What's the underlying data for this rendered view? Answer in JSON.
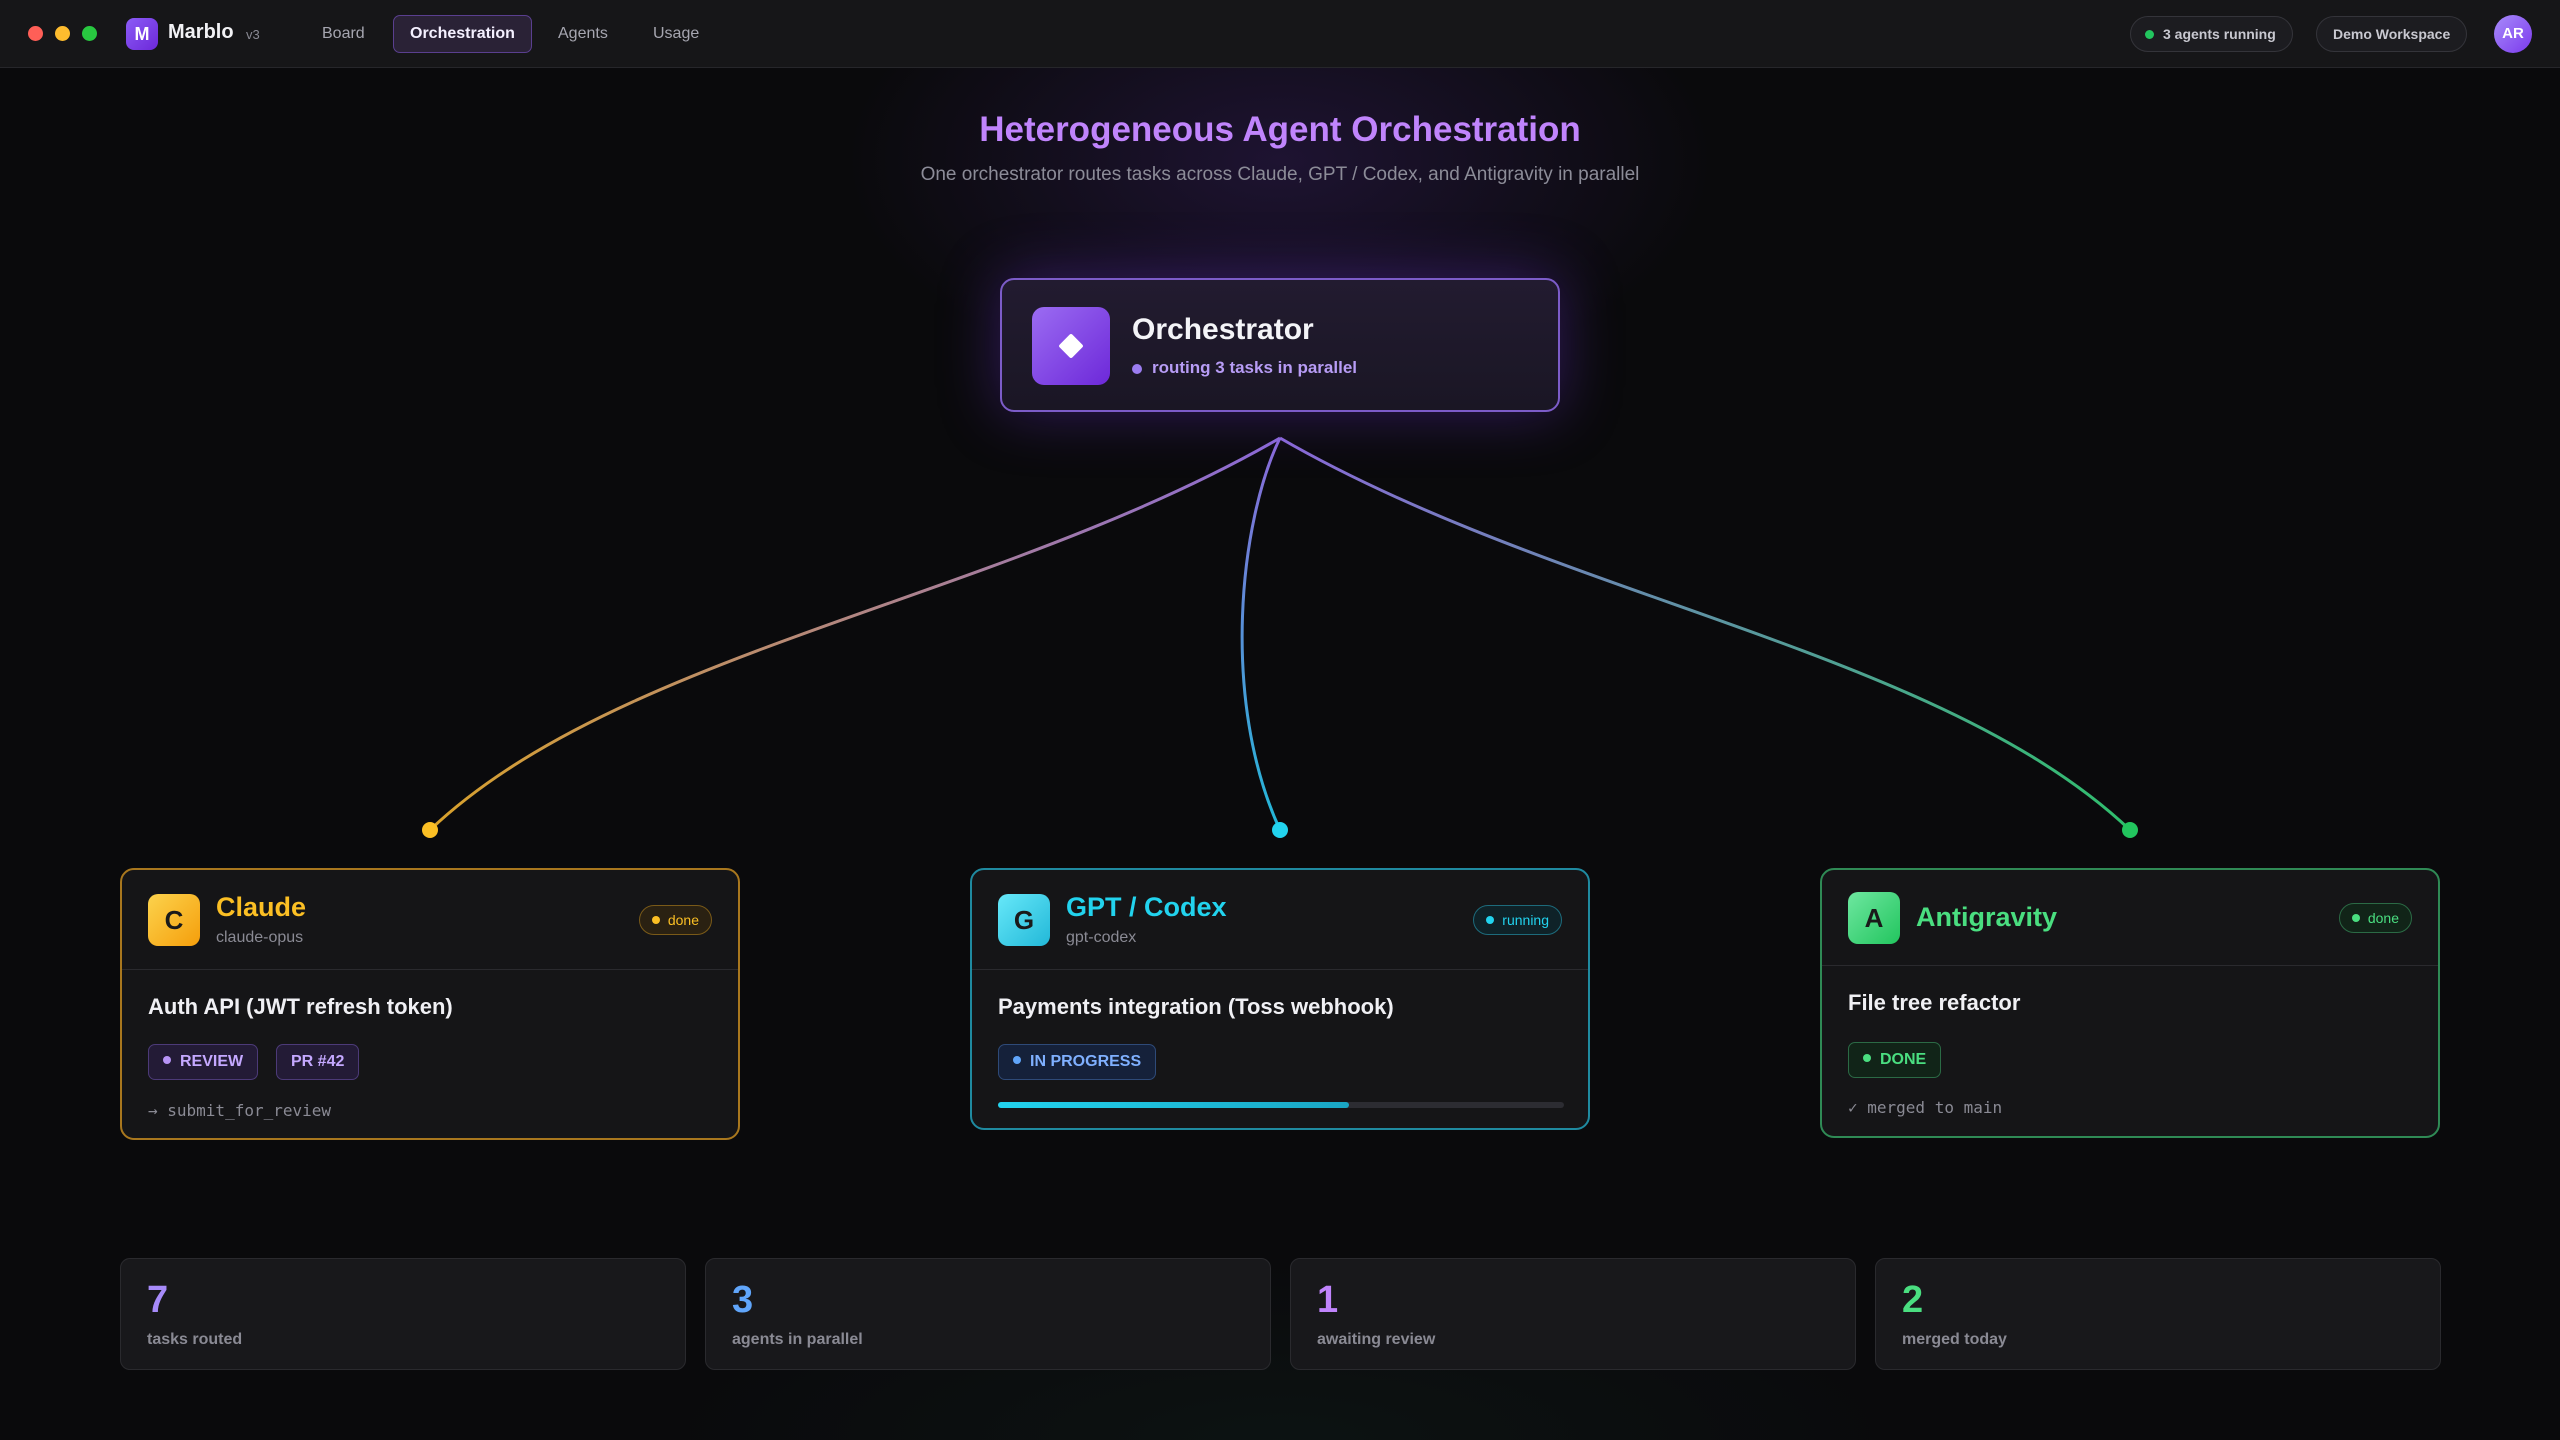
{
  "app": {
    "logo_letter": "M",
    "name": "Marblo",
    "version": "v3"
  },
  "nav": {
    "items": [
      {
        "label": "Board"
      },
      {
        "label": "Orchestration",
        "active": true
      },
      {
        "label": "Agents"
      },
      {
        "label": "Usage"
      }
    ]
  },
  "header_right": {
    "status": "3 agents running",
    "workspace": "Demo Workspace",
    "avatar_initials": "AR"
  },
  "page": {
    "title": "Heterogeneous Agent Orchestration",
    "subtitle": "One orchestrator routes tasks across Claude, GPT / Codex, and Antigravity in parallel"
  },
  "orchestrator": {
    "name": "Orchestrator",
    "status": "routing 3 tasks in parallel",
    "icon": "diamond-icon"
  },
  "agents": [
    {
      "icon_letter": "C",
      "name": "Claude",
      "model": "claude-opus",
      "badge": "done",
      "task": "Auth API (JWT refresh token)",
      "tags": [
        "REVIEW",
        "PR #42"
      ],
      "footer": "→ submit_for_review",
      "color": "#fbbf24"
    },
    {
      "icon_letter": "G",
      "name": "GPT / Codex",
      "model": "gpt-codex",
      "badge": "running",
      "task": "Payments integration (Toss webhook)",
      "tags": [
        "IN PROGRESS"
      ],
      "progress": 0.62,
      "color": "#22d3ee"
    },
    {
      "icon_letter": "A",
      "name": "Antigravity",
      "badge": "done",
      "task": "File tree refactor",
      "tags": [
        "DONE"
      ],
      "footer": "✓ merged to main",
      "color": "#4ade80"
    }
  ],
  "stats": [
    {
      "value": "7",
      "label": "tasks routed"
    },
    {
      "value": "3",
      "label": "agents in parallel"
    },
    {
      "value": "1",
      "label": "awaiting review"
    },
    {
      "value": "2",
      "label": "merged today"
    }
  ],
  "colors": {
    "accent": "#8b5cf6",
    "claude": "#fbbf24",
    "gpt": "#22d3ee",
    "antigravity": "#4ade80"
  }
}
